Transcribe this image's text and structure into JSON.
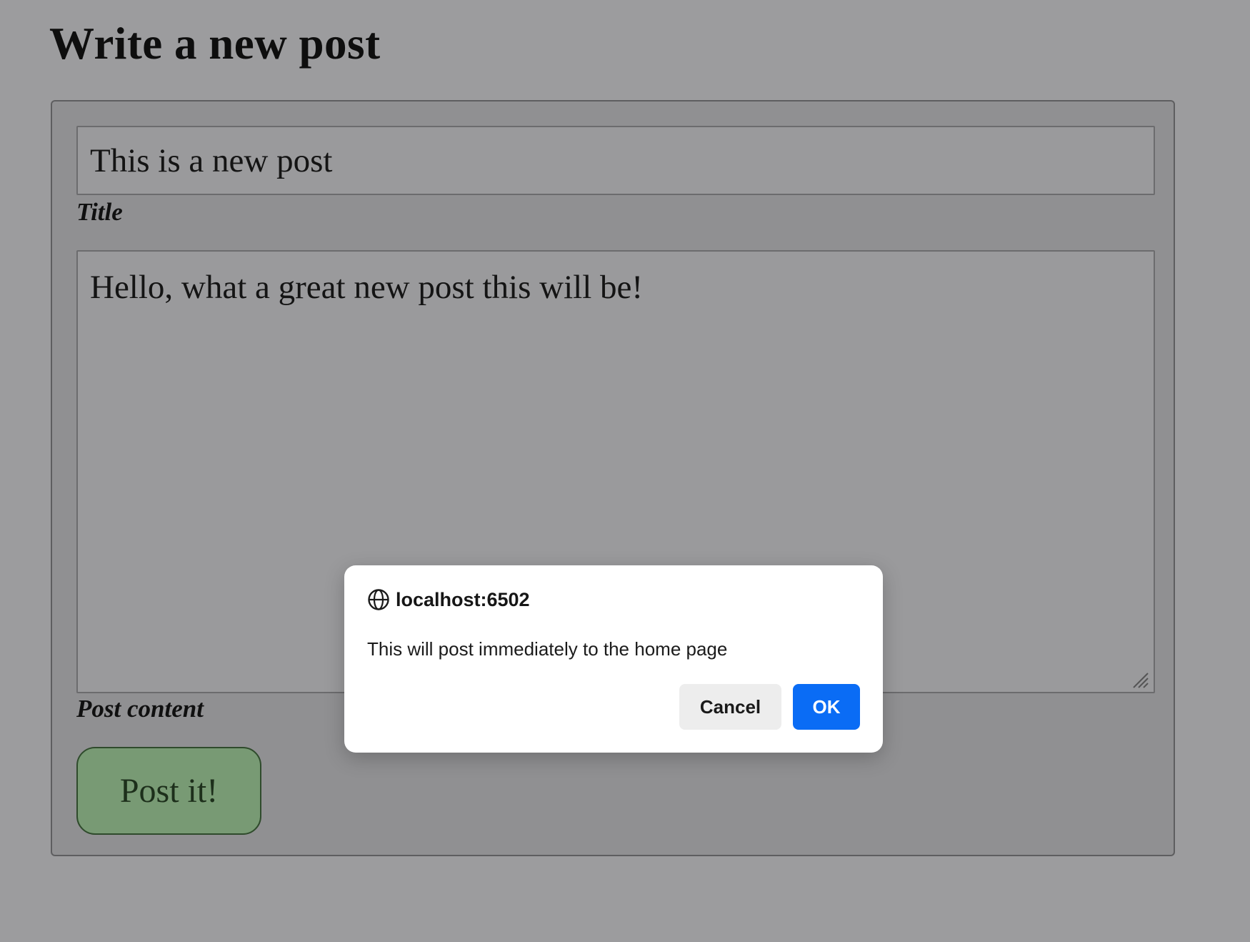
{
  "page": {
    "title": "Write a new post"
  },
  "form": {
    "title_value": "This is a new post",
    "title_label": "Title",
    "content_value": "Hello, what a great new post this will be!",
    "content_label": "Post content",
    "submit_label": "Post it!"
  },
  "dialog": {
    "origin": "localhost:6502",
    "message": "This will post immediately to the home page",
    "cancel_label": "Cancel",
    "ok_label": "OK",
    "icon": "globe-icon"
  },
  "colors": {
    "page_background": "#9c9c9e",
    "submit_button": "#789a74",
    "ok_button": "#0a6cf5",
    "cancel_button": "#ededed"
  }
}
